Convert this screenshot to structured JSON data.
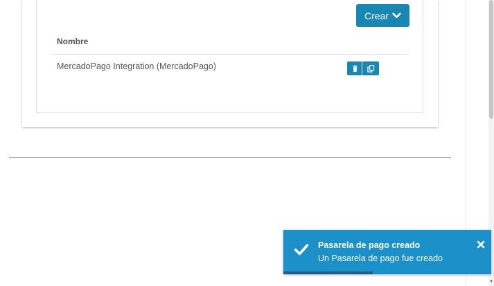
{
  "colors": {
    "primary": "#1a87b3",
    "toast_bg": "#1c91c9",
    "toast_progress": "#1a5f86"
  },
  "toolbar": {
    "create_label": "Crear",
    "create_icon": "chevron-down-icon"
  },
  "table": {
    "columns": [
      "Nombre"
    ],
    "rows": [
      {
        "name": "MercadoPago Integration (MercadoPago)",
        "actions": [
          "trash-icon",
          "copy-icon"
        ]
      }
    ]
  },
  "toast": {
    "icon": "check-icon",
    "title": "Pasarela de pago creado",
    "message": "Un Pasarela de pago fue creado",
    "close_icon": "close-icon",
    "progress": 0.43
  }
}
